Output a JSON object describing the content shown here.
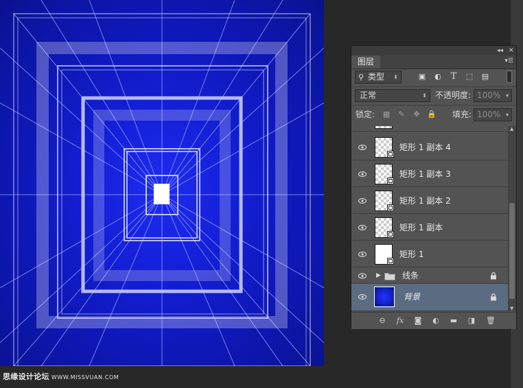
{
  "panel": {
    "tab_label": "图层",
    "filter": {
      "label": "类型"
    },
    "blend_mode": "正常",
    "opacity_label": "不透明度:",
    "opacity_value": "100%",
    "lock_label": "锁定:",
    "fill_label": "填充:",
    "fill_value": "100%"
  },
  "layers": [
    {
      "name": "矩形 1 副本 4",
      "thumb": "checker",
      "visible": true
    },
    {
      "name": "矩形 1 副本 3",
      "thumb": "checker",
      "visible": true
    },
    {
      "name": "矩形 1 副本 2",
      "thumb": "checker",
      "visible": true
    },
    {
      "name": "矩形 1 副本",
      "thumb": "checker",
      "visible": true
    },
    {
      "name": "矩形 1",
      "thumb": "white",
      "visible": true
    },
    {
      "name": "线条",
      "type": "group",
      "locked": true,
      "visible": true
    },
    {
      "name": "背景",
      "thumb": "blue",
      "locked": true,
      "selected": true,
      "visible": true
    }
  ],
  "watermark": {
    "text": "思缘设计论坛",
    "site": "WWW.MISSVUAN.COM"
  },
  "colors": {
    "canvas_blue": "#1420d8",
    "panel_bg": "#535353",
    "selected_row": "#5b6b81",
    "workspace": "#282828"
  }
}
